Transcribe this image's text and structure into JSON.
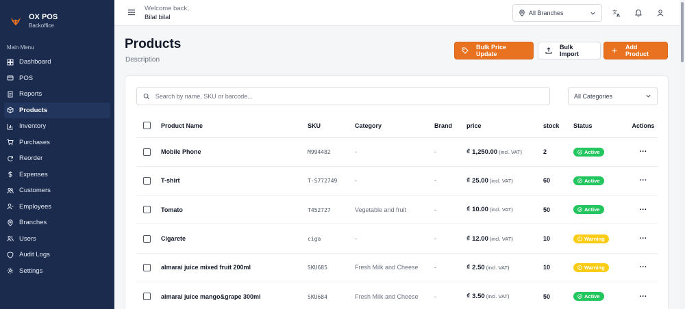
{
  "app": {
    "name": "OX POS",
    "subtitle": "Backoffice"
  },
  "sidebar": {
    "section_title": "Main Menu",
    "items": [
      {
        "label": "Dashboard",
        "icon": "dashboard-icon"
      },
      {
        "label": "POS",
        "icon": "pos-icon"
      },
      {
        "label": "Reports",
        "icon": "reports-icon"
      },
      {
        "label": "Products",
        "icon": "products-icon",
        "active": true
      },
      {
        "label": "Inventory",
        "icon": "inventory-icon"
      },
      {
        "label": "Purchases",
        "icon": "cart-icon"
      },
      {
        "label": "Reorder",
        "icon": "reorder-icon"
      },
      {
        "label": "Expenses",
        "icon": "dollar-icon"
      },
      {
        "label": "Customers",
        "icon": "customers-icon"
      },
      {
        "label": "Employees",
        "icon": "employees-icon"
      },
      {
        "label": "Branches",
        "icon": "location-icon"
      },
      {
        "label": "Users",
        "icon": "users-icon"
      },
      {
        "label": "Audit Logs",
        "icon": "shield-icon"
      },
      {
        "label": "Settings",
        "icon": "gear-icon"
      }
    ]
  },
  "header": {
    "welcome": "Welcome back,",
    "user": "Bilal bilal",
    "branch": "All Branches"
  },
  "page": {
    "title": "Products",
    "description": "Description",
    "buttons": {
      "bulk_price": "Bulk Price Update",
      "bulk_import": "Bulk Import",
      "add_product": "Add Product"
    }
  },
  "filters": {
    "search_placeholder": "Search by name, SKU or barcode...",
    "category": "All Categories"
  },
  "table": {
    "columns": {
      "name": "Product Name",
      "sku": "SKU",
      "category": "Category",
      "brand": "Brand",
      "price": "price",
      "stock": "stock",
      "status": "Status",
      "actions": "Actions"
    },
    "currency_symbol": "₫",
    "vat_note": "(incl. VAT)",
    "rows": [
      {
        "name": "Mobile Phone",
        "sku": "M994482",
        "category": "-",
        "brand": "-",
        "price": "1,250.00",
        "stock": "2",
        "status": "Active"
      },
      {
        "name": "T-shirt",
        "sku": "T-S772749",
        "category": "-",
        "brand": "-",
        "price": "25.00",
        "stock": "60",
        "status": "Active"
      },
      {
        "name": "Tomato",
        "sku": "T452727",
        "category": "Vegetable and fruit",
        "brand": "-",
        "price": "10.00",
        "stock": "50",
        "status": "Active"
      },
      {
        "name": "Cigarete",
        "sku": "ciga",
        "category": "-",
        "brand": "-",
        "price": "12.00",
        "stock": "10",
        "status": "Warning"
      },
      {
        "name": "almarai juice mixed fruit 200ml",
        "sku": "SKU685",
        "category": "Fresh Milk and Cheese",
        "brand": "-",
        "price": "2.50",
        "stock": "10",
        "status": "Warning"
      },
      {
        "name": "almarai juice mango&grape 300ml",
        "sku": "SKU684",
        "category": "Fresh Milk and Cheese",
        "brand": "-",
        "price": "3.50",
        "stock": "50",
        "status": "Active"
      }
    ]
  },
  "colors": {
    "sidebar_bg": "#1a2b4d",
    "accent": "#e8721f",
    "active": "#22c55e",
    "warning": "#facc15"
  }
}
